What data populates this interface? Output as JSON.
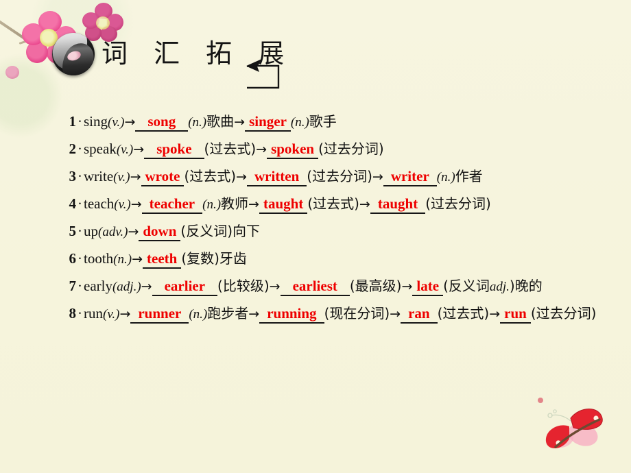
{
  "slide": {
    "background_color": "#f6f4dd",
    "title": "词 汇 拓 展",
    "logo_icon": "yin-yang-orb-icon",
    "arrow_icon": "left-arrow-bracket-icon",
    "decorations": [
      {
        "name": "plum-blossom-decoration",
        "position": "top-left"
      },
      {
        "name": "butterfly-decoration",
        "position": "bottom-right"
      }
    ],
    "accent_color": "#ee0000",
    "text_color": "#121212"
  },
  "items": [
    {
      "number": "1",
      "segments": [
        {
          "type": "word",
          "text": "sing"
        },
        {
          "type": "pos",
          "text": "(v.)"
        },
        {
          "type": "arrow",
          "text": "→"
        },
        {
          "type": "answer",
          "text": "song",
          "pad": "pad-l"
        },
        {
          "type": "pos",
          "text": "(n.)"
        },
        {
          "type": "cn",
          "text": "歌曲"
        },
        {
          "type": "arrow",
          "text": "→"
        },
        {
          "type": "answer",
          "text": "singer",
          "pad": "pad-m"
        },
        {
          "type": "pos",
          "text": "(n.)"
        },
        {
          "type": "cn",
          "text": "歌手"
        }
      ]
    },
    {
      "number": "2",
      "segments": [
        {
          "type": "word",
          "text": "speak"
        },
        {
          "type": "pos",
          "text": "(v.)"
        },
        {
          "type": "arrow",
          "text": "→"
        },
        {
          "type": "answer",
          "text": "spoke",
          "pad": "pad-l"
        },
        {
          "type": "cn",
          "text": "(过去式)"
        },
        {
          "type": "arrow",
          "text": "→"
        },
        {
          "type": "answer",
          "text": "spoken",
          "pad": "pad-m"
        },
        {
          "type": "cn",
          "text": "(过去分词)"
        }
      ]
    },
    {
      "number": "3",
      "segments": [
        {
          "type": "word",
          "text": "write"
        },
        {
          "type": "pos",
          "text": "(v.)"
        },
        {
          "type": "arrow",
          "text": "→"
        },
        {
          "type": "answer",
          "text": "wrote",
          "pad": "pad-m"
        },
        {
          "type": "cn",
          "text": "(过去式)"
        },
        {
          "type": "arrow",
          "text": "→"
        },
        {
          "type": "answer",
          "text": "written",
          "pad": "pad-s"
        },
        {
          "type": "cn",
          "text": "(过去分词)"
        },
        {
          "type": "arrow",
          "text": "→"
        },
        {
          "type": "answer",
          "text": "writer",
          "pad": "pad-s"
        },
        {
          "type": "pos",
          "text": "(n.)"
        },
        {
          "type": "cn",
          "text": "作者"
        }
      ]
    },
    {
      "number": "4",
      "segments": [
        {
          "type": "word",
          "text": "teach"
        },
        {
          "type": "pos",
          "text": "(v.)"
        },
        {
          "type": "arrow",
          "text": "→"
        },
        {
          "type": "answer",
          "text": "teacher",
          "pad": "pad-s"
        },
        {
          "type": "pos",
          "text": "(n.)"
        },
        {
          "type": "cn",
          "text": "教师"
        },
        {
          "type": "arrow",
          "text": "→"
        },
        {
          "type": "answer",
          "text": "taught",
          "pad": "pad-m"
        },
        {
          "type": "cn",
          "text": "(过去式)"
        },
        {
          "type": "arrow",
          "text": "→"
        },
        {
          "type": "answer",
          "text": "taught",
          "pad": "pad-s"
        },
        {
          "type": "cn",
          "text": "(过去分词)"
        }
      ]
    },
    {
      "number": "5",
      "segments": [
        {
          "type": "word",
          "text": "up"
        },
        {
          "type": "pos",
          "text": "(adv.)"
        },
        {
          "type": "arrow",
          "text": "→"
        },
        {
          "type": "answer",
          "text": "down",
          "pad": "pad-m"
        },
        {
          "type": "cn",
          "text": "(反义词)"
        },
        {
          "type": "cn",
          "text": "向下"
        }
      ]
    },
    {
      "number": "6",
      "segments": [
        {
          "type": "word",
          "text": "tooth"
        },
        {
          "type": "pos",
          "text": "(n.)"
        },
        {
          "type": "arrow",
          "text": "→"
        },
        {
          "type": "answer",
          "text": "teeth",
          "pad": "pad-m"
        },
        {
          "type": "cn",
          "text": "(复数)"
        },
        {
          "type": "cn",
          "text": "牙齿"
        }
      ]
    },
    {
      "number": "7",
      "segments": [
        {
          "type": "word",
          "text": "early"
        },
        {
          "type": "pos",
          "text": "(adj.)"
        },
        {
          "type": "arrow",
          "text": "→"
        },
        {
          "type": "answer",
          "text": "earlier",
          "pad": "pad-l"
        },
        {
          "type": "cn",
          "text": "(比较级)"
        },
        {
          "type": "arrow",
          "text": "→"
        },
        {
          "type": "answer",
          "text": "earliest",
          "pad": "pad-l"
        },
        {
          "type": "cn",
          "text": "(最高级)"
        },
        {
          "type": "arrow",
          "text": "→"
        },
        {
          "type": "answer",
          "text": "late",
          "pad": "pad-m"
        },
        {
          "type": "cn",
          "text": "(反义词"
        },
        {
          "type": "pos",
          "text": "adj."
        },
        {
          "type": "cn",
          "text": ")晚的"
        }
      ]
    },
    {
      "number": "8",
      "segments": [
        {
          "type": "word",
          "text": "run"
        },
        {
          "type": "pos",
          "text": "(v.)"
        },
        {
          "type": "arrow",
          "text": "→"
        },
        {
          "type": "answer",
          "text": "runner",
          "pad": "pad-s"
        },
        {
          "type": "pos",
          "text": "(n.)"
        },
        {
          "type": "cn",
          "text": "跑步者"
        },
        {
          "type": "arrow",
          "text": "→"
        },
        {
          "type": "answer",
          "text": "running",
          "pad": "pad-s"
        },
        {
          "type": "cn",
          "text": "(现在分词)"
        },
        {
          "type": "arrow",
          "text": "→"
        },
        {
          "type": "answer",
          "text": "ran",
          "pad": "pad-s"
        },
        {
          "type": "cn",
          "text": "(过去式)"
        },
        {
          "type": "arrow",
          "text": "→"
        },
        {
          "type": "answer",
          "text": "run",
          "pad": "pad-m"
        },
        {
          "type": "cn",
          "text": "(过去分词)"
        }
      ]
    }
  ],
  "separators": {
    "bullet": "·"
  }
}
